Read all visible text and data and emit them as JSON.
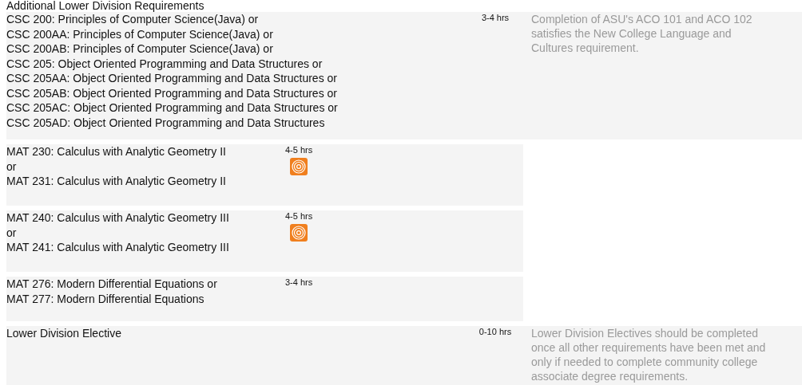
{
  "heading": "Additional Lower Division Requirements",
  "rows": [
    {
      "kind": "wide",
      "courses": [
        "CSC 200: Principles of Computer Science(Java) or",
        "CSC 200AA: Principles of Computer Science(Java) or",
        "CSC 200AB: Principles of Computer Science(Java) or",
        "CSC 205: Object Oriented Programming and Data Structures or",
        "CSC 205AA: Object Oriented Programming and Data Structures or",
        "CSC 205AB: Object Oriented Programming and Data Structures or",
        "CSC 205AC: Object Oriented Programming and Data Structures or",
        "CSC 205AD: Object Oriented Programming and Data Structures"
      ],
      "hours": "3-4 hrs",
      "icon": false,
      "note": "Completion of ASU's ACO 101 and ACO 102 satisfies the New College Language and Cultures requirement."
    },
    {
      "kind": "narrow",
      "courses": [
        "MAT 230: Calculus with Analytic Geometry II",
        "or",
        "MAT 231: Calculus with Analytic Geometry II"
      ],
      "hours": "4-5 hrs",
      "icon": true
    },
    {
      "kind": "narrow",
      "courses": [
        "MAT 240: Calculus with Analytic Geometry III",
        "or",
        "MAT 241: Calculus with Analytic Geometry III"
      ],
      "hours": "4-5 hrs",
      "icon": true
    },
    {
      "kind": "narrow",
      "courses": [
        "MAT 276: Modern Differential Equations or",
        "MAT 277: Modern Differential Equations"
      ],
      "hours": "3-4 hrs",
      "icon": false
    },
    {
      "kind": "wide",
      "courses": [
        "Lower Division Elective"
      ],
      "hours": "0-10 hrs",
      "icon": false,
      "note": "Lower Division Electives should be completed once all other requirements have been met and only if needed to complete community college associate degree requirements."
    }
  ]
}
